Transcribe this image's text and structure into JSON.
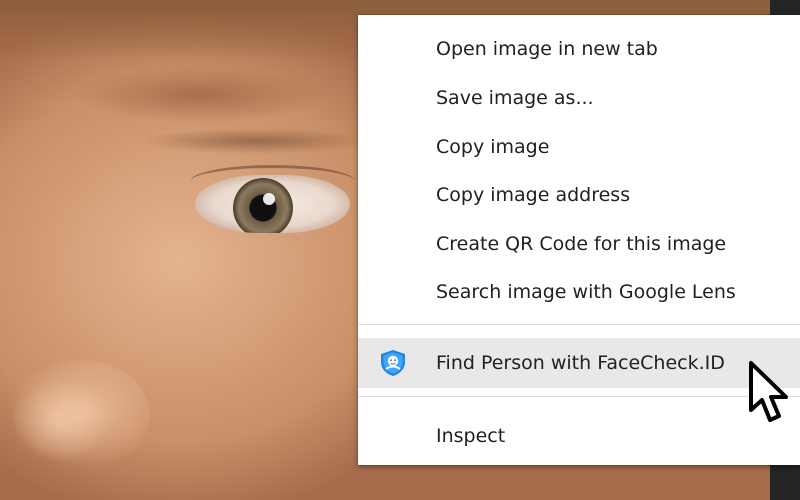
{
  "context_menu": {
    "items": [
      {
        "label": "Open image in new tab"
      },
      {
        "label": "Save image as..."
      },
      {
        "label": "Copy image"
      },
      {
        "label": "Copy image address"
      },
      {
        "label": "Create QR Code for this image"
      },
      {
        "label": "Search image with Google Lens"
      }
    ],
    "extension_item": {
      "label": "Find Person with FaceCheck.ID",
      "icon": "facecheck-shield-icon",
      "highlighted": true
    },
    "inspect_item": {
      "label": "Inspect"
    }
  },
  "colors": {
    "menu_background": "#ffffff",
    "highlight": "#e8e8e8",
    "text": "#202124",
    "separator": "#dadce0",
    "icon_blue": "#1e88e5"
  },
  "icons": [
    "facecheck-shield-icon",
    "mouse-pointer-icon"
  ]
}
